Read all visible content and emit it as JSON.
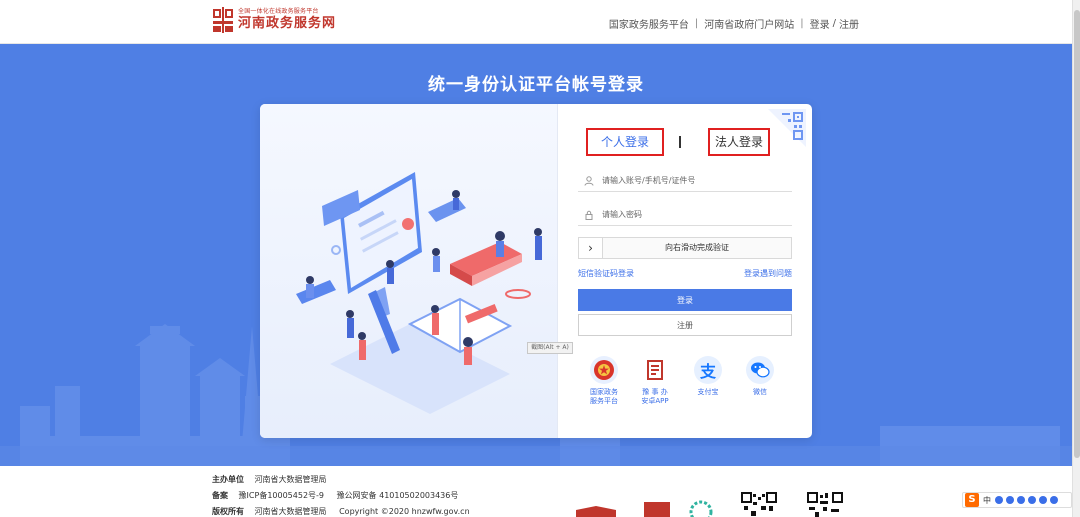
{
  "header": {
    "logo_small": "全国一体化在线政务服务平台",
    "logo_title": "河南政务服务网",
    "nav": [
      "国家政务服务平台",
      "河南省政府门户网站"
    ],
    "login": "登录",
    "register": "注册",
    "sep": "|",
    "slash": "/"
  },
  "hero": {
    "title": "统一身份认证平台帐号登录"
  },
  "login": {
    "tab_person": "个人登录",
    "tab_corp": "法人登录",
    "account_placeholder": "请输入账号/手机号/证件号",
    "password_placeholder": "请输入密码",
    "slider_text": "向右滑动完成验证",
    "slider_handle": "›",
    "sms_login": "短信验证码登录",
    "login_problem": "登录遇到问题",
    "login_button": "登录",
    "register_button": "注册"
  },
  "socials": [
    {
      "label": "国家政务\n服务平台",
      "icon": "national-emblem-icon",
      "color": "#3a6ee8"
    },
    {
      "label": "豫 事 办\n安卓APP",
      "icon": "yushiban-icon",
      "color": "#c0362c"
    },
    {
      "label": "支付宝",
      "icon": "alipay-icon",
      "color": "#1677ff"
    },
    {
      "label": "微信",
      "icon": "wechat-icon",
      "color": "#1677ff"
    }
  ],
  "tooltip": "截图(Alt + A)",
  "footer": {
    "sponsor_label": "主办单位",
    "sponsor": "河南省大数据管理局",
    "record_label": "备案",
    "icp": "豫ICP备10005452号-9",
    "police": "豫公网安备 41010502003436号",
    "copyright_label": "版权所有",
    "copyright_owner": "河南省大数据管理局",
    "copyright": "Copyright ©2020 hnzwfw.gov.cn"
  },
  "ime": {
    "label": "中"
  },
  "colors": {
    "primary_blue": "#4f7fe4",
    "button_blue": "#4a7ae6",
    "brand_red": "#c0362c",
    "highlight_red": "#e02020"
  }
}
